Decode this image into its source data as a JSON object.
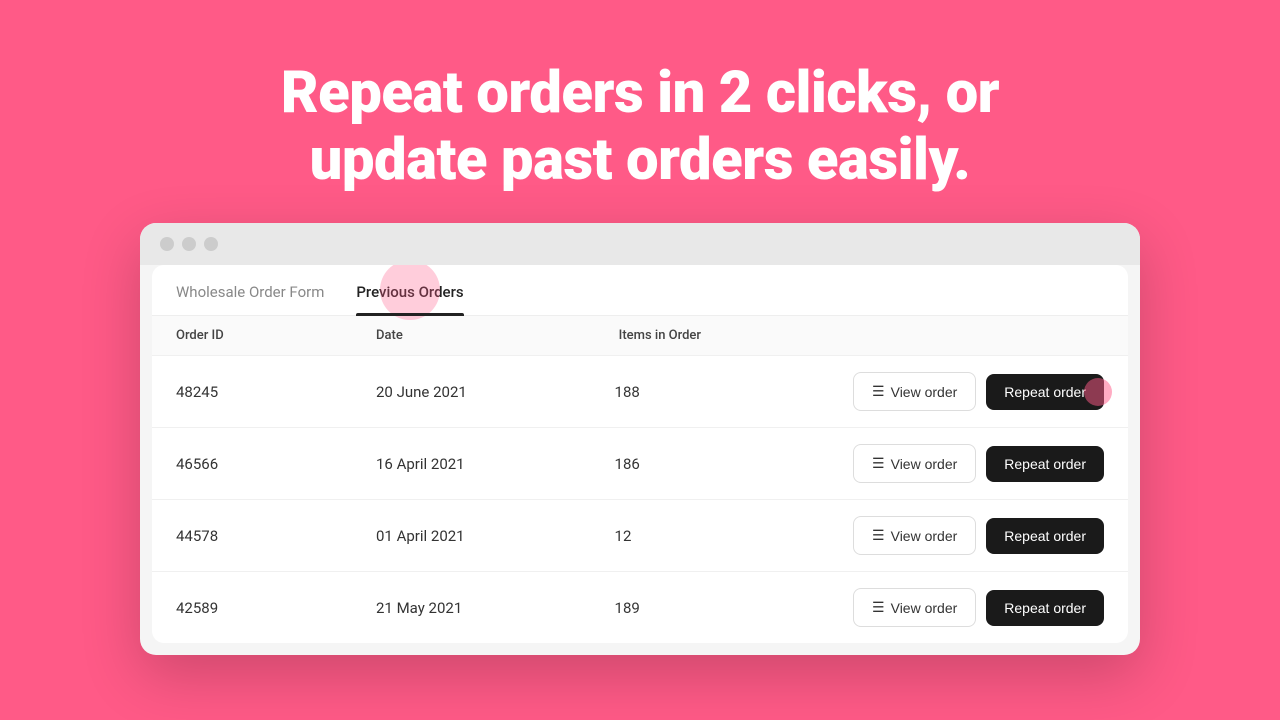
{
  "hero": {
    "line1": "Repeat orders in 2 clicks, or",
    "line2": "update past orders easily."
  },
  "browser": {
    "tabs": [
      {
        "label": "Wholesale Order Form",
        "active": false
      },
      {
        "label": "Previous Orders",
        "active": true
      }
    ],
    "table": {
      "headers": [
        "Order ID",
        "Date",
        "Items in Order",
        ""
      ],
      "rows": [
        {
          "id": "48245",
          "date": "20 June 2021",
          "items": "188",
          "highlighted": true
        },
        {
          "id": "46566",
          "date": "16 April 2021",
          "items": "186",
          "highlighted": false
        },
        {
          "id": "44578",
          "date": "01 April 2021",
          "items": "12",
          "highlighted": false
        },
        {
          "id": "42589",
          "date": "21 May 2021",
          "items": "189",
          "highlighted": false
        }
      ],
      "view_label": "View order",
      "repeat_label": "Repeat order"
    }
  },
  "colors": {
    "background": "#FF5A87",
    "button_dark": "#1a1a1a",
    "tab_active_border": "#1a1a1a"
  }
}
